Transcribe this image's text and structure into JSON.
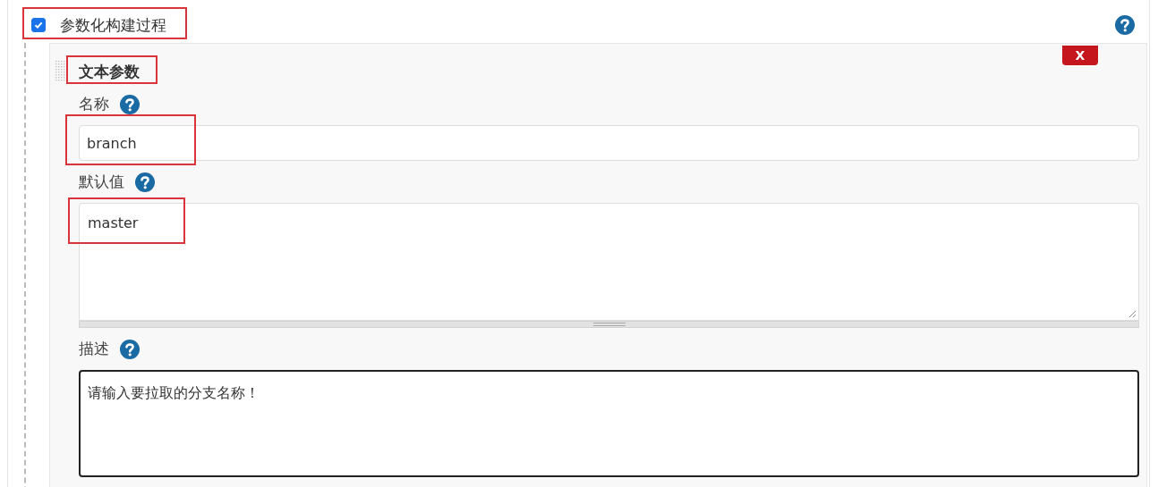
{
  "parameterized": {
    "label": "参数化构建过程",
    "checked": true,
    "highlighted": true
  },
  "parameter": {
    "title": "文本参数",
    "title_highlighted": true,
    "delete_label": "X",
    "fields": [
      {
        "kind": "input",
        "label": "名称",
        "value": "branch",
        "highlighted": true
      },
      {
        "kind": "textarea",
        "label": "默认值",
        "value": "master",
        "highlighted": true
      },
      {
        "kind": "textarea_focused",
        "label": "描述",
        "value": "请输入要拉取的分支名称！"
      }
    ]
  }
}
